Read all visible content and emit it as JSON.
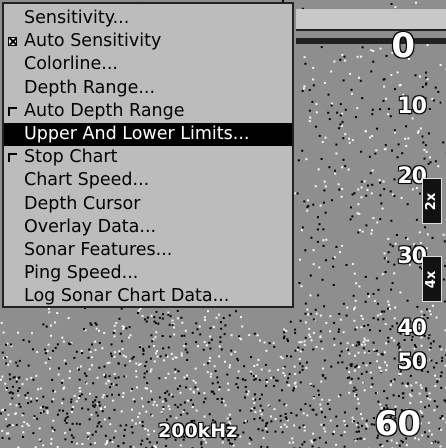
{
  "menu": {
    "items": [
      {
        "label": "Sensitivity...",
        "check": "none",
        "selected": false
      },
      {
        "label": "Auto Sensitivity",
        "check": "on",
        "selected": false
      },
      {
        "label": "Colorline...",
        "check": "none",
        "selected": false
      },
      {
        "label": "Depth Range...",
        "check": "none",
        "selected": false
      },
      {
        "label": "Auto Depth Range",
        "check": "off",
        "selected": false
      },
      {
        "label": "Upper And Lower Limits...",
        "check": "none",
        "selected": true
      },
      {
        "label": "Stop Chart",
        "check": "off",
        "selected": false
      },
      {
        "label": "Chart Speed...",
        "check": "none",
        "selected": false
      },
      {
        "label": "Depth Cursor",
        "check": "none",
        "selected": false
      },
      {
        "label": "Overlay Data...",
        "check": "none",
        "selected": false
      },
      {
        "label": "Sonar Features...",
        "check": "none",
        "selected": false
      },
      {
        "label": "Ping Speed...",
        "check": "none",
        "selected": false
      },
      {
        "label": "Log Sonar Chart Data...",
        "check": "none",
        "selected": false
      }
    ]
  },
  "depth_scale": [
    "0",
    "10",
    "20",
    "30",
    "40",
    "50",
    "60"
  ],
  "zoom": {
    "badge_2x": "2x",
    "badge_4x": "4x"
  },
  "frequency": "200kHz",
  "colors": {
    "menu_bg": "#bcbcbc",
    "selected_bg": "#000000",
    "sonar_bg": "#8e8e8e"
  }
}
